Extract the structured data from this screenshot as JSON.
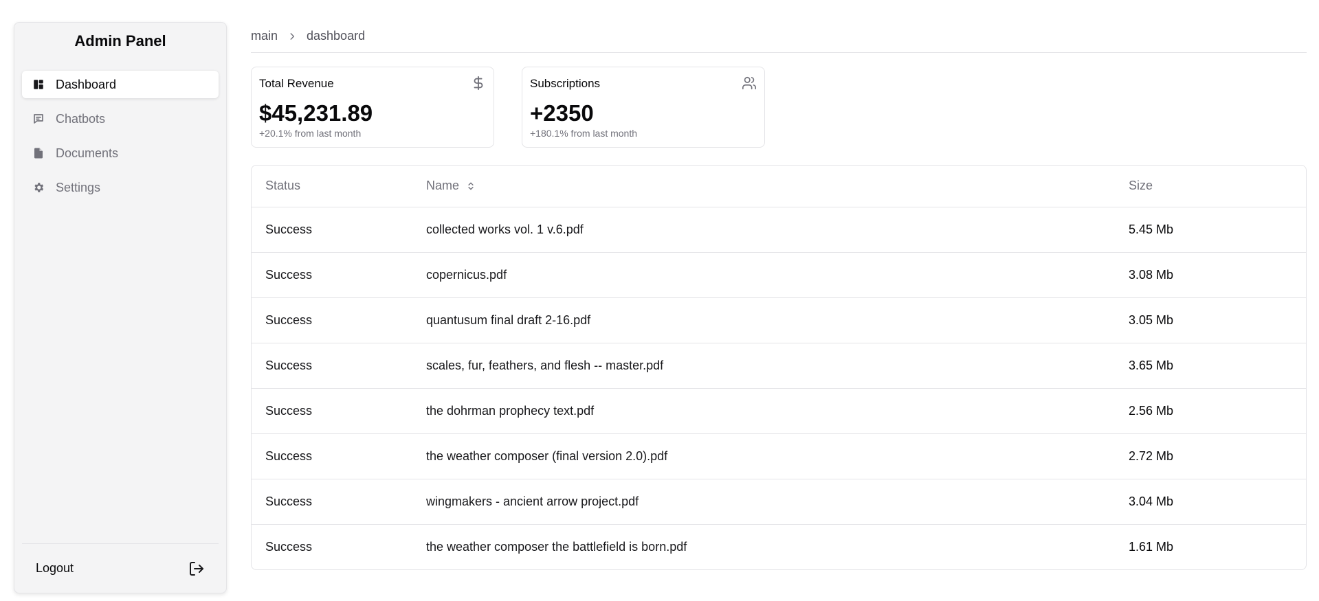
{
  "sidebar": {
    "title": "Admin Panel",
    "items": [
      {
        "label": "Dashboard",
        "icon": "dashboard-icon",
        "active": true
      },
      {
        "label": "Chatbots",
        "icon": "chatbot-icon",
        "active": false
      },
      {
        "label": "Documents",
        "icon": "document-icon",
        "active": false
      },
      {
        "label": "Settings",
        "icon": "gear-icon",
        "active": false
      }
    ],
    "logout_label": "Logout"
  },
  "breadcrumb": {
    "root": "main",
    "current": "dashboard"
  },
  "cards": [
    {
      "label": "Total Revenue",
      "icon": "dollar-icon",
      "value": "$45,231.89",
      "note": "+20.1% from last month"
    },
    {
      "label": "Subscriptions",
      "icon": "users-icon",
      "value": "+2350",
      "note": "+180.1% from last month"
    }
  ],
  "table": {
    "headers": {
      "status": "Status",
      "name": "Name",
      "size": "Size"
    },
    "rows": [
      {
        "status": "Success",
        "name": "collected works vol. 1 v.6.pdf",
        "size": "5.45 Mb"
      },
      {
        "status": "Success",
        "name": "copernicus.pdf",
        "size": "3.08 Mb"
      },
      {
        "status": "Success",
        "name": "quantusum final draft 2-16.pdf",
        "size": "3.05 Mb"
      },
      {
        "status": "Success",
        "name": "scales, fur, feathers, and flesh -- master.pdf",
        "size": "3.65 Mb"
      },
      {
        "status": "Success",
        "name": "the dohrman prophecy text.pdf",
        "size": "2.56 Mb"
      },
      {
        "status": "Success",
        "name": "the weather composer (final version 2.0).pdf",
        "size": "2.72 Mb"
      },
      {
        "status": "Success",
        "name": "wingmakers - ancient arrow project.pdf",
        "size": "3.04 Mb"
      },
      {
        "status": "Success",
        "name": "the weather composer the battlefield is born.pdf",
        "size": "1.61 Mb"
      }
    ]
  }
}
